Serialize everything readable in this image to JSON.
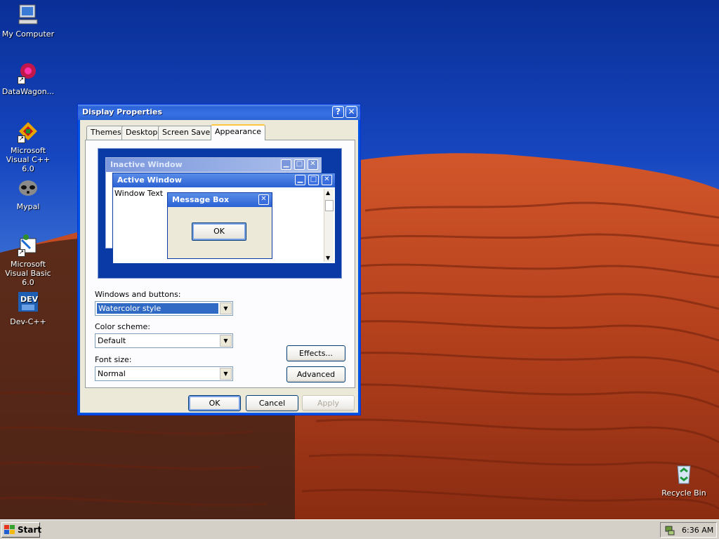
{
  "desktop": {
    "icons": [
      {
        "label": "My Computer",
        "icon": "my-computer-icon"
      },
      {
        "label": "DataWagon...",
        "icon": "datawagon-icon"
      },
      {
        "label": "Microsoft Visual C++ 6.0",
        "icon": "visual-cpp-icon"
      },
      {
        "label": "Mypal",
        "icon": "mypal-icon"
      },
      {
        "label": "Microsoft Visual Basic 6.0",
        "icon": "visual-basic-icon"
      },
      {
        "label": "Dev-C++",
        "icon": "dev-cpp-icon"
      },
      {
        "label": "Recycle Bin",
        "icon": "recycle-bin-icon"
      }
    ],
    "shortcut_glyph": "↗"
  },
  "dialog": {
    "title": "Display Properties",
    "help_glyph": "?",
    "close_glyph": "✕",
    "tabs": [
      "Themes",
      "Desktop",
      "Screen Saver",
      "Appearance"
    ],
    "active_tab": "Appearance",
    "preview": {
      "inactive_title": "Inactive Window",
      "active_title": "Active Window",
      "window_text": "Window Text",
      "message_title": "Message Box",
      "ok_label": "OK",
      "min_glyph": "▁",
      "max_glyph": "□",
      "close_glyph": "✕",
      "scroll_up": "▲",
      "scroll_down": "▼"
    },
    "fields": {
      "windows_buttons_label": "Windows and buttons:",
      "windows_buttons_value": "Watercolor style",
      "color_scheme_label": "Color scheme:",
      "color_scheme_value": "Default",
      "font_size_label": "Font size:",
      "font_size_value": "Normal",
      "dropdown_glyph": "▼"
    },
    "buttons": {
      "effects": "Effects...",
      "advanced": "Advanced",
      "ok": "OK",
      "cancel": "Cancel",
      "apply": "Apply"
    }
  },
  "taskbar": {
    "start_label": "Start",
    "clock": "6:36 AM"
  },
  "colors": {
    "title_blue": "#2a64d8",
    "selection": "#316ac5",
    "dialog_face": "#ece9d8",
    "dune": "#b8401a"
  }
}
